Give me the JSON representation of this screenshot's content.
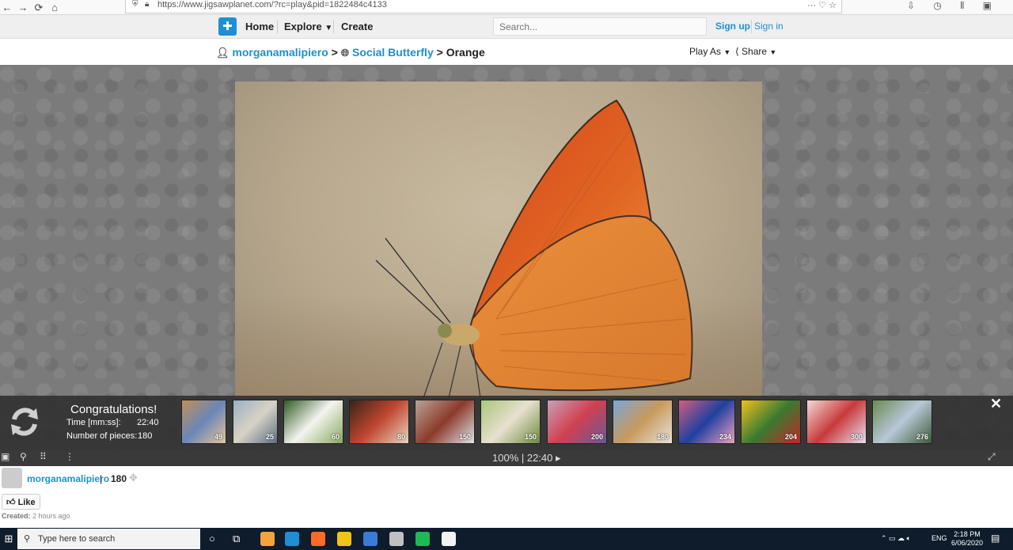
{
  "browser": {
    "url": "https://www.jigsawplanet.com/?rc=play&pid=1822484c4133",
    "url_icons": "··· ♡ ☆",
    "ext_icons": "⇩ ◷ ⫴ ▣ ☺"
  },
  "header": {
    "nav": [
      "Home",
      "Explore",
      "Create"
    ],
    "search_placeholder": "Search...",
    "signup": "Sign up",
    "signin": "Sign in"
  },
  "breadcrumb": {
    "user": "morganamalipiero",
    "sep1": ">",
    "collection": "Social Butterfly",
    "sep2": ">",
    "title": "Orange",
    "play_as": "Play As",
    "share": "Share"
  },
  "congrats": {
    "title": "Congratulations!",
    "time_label": "Time [mm:ss]:",
    "time_value": "22:40",
    "pieces_label": "Number of pieces:",
    "pieces_value": "180"
  },
  "thumbnails": [
    {
      "count": "49",
      "colors": [
        "#c28f5a",
        "#6a86b8",
        "#e6c69a"
      ]
    },
    {
      "count": "25",
      "colors": [
        "#9ab0c8",
        "#d8d2c4",
        "#5c6f86"
      ]
    },
    {
      "count": "60",
      "colors": [
        "#2f5b24",
        "#f4f4f0",
        "#88a860"
      ]
    },
    {
      "count": "80",
      "colors": [
        "#3a2418",
        "#c04630",
        "#e8d4c0"
      ]
    },
    {
      "count": "150",
      "colors": [
        "#b9a496",
        "#8c3a2a",
        "#e0e4ea"
      ]
    },
    {
      "count": "150",
      "colors": [
        "#a8c878",
        "#e8e0d0",
        "#6c8a3a"
      ]
    },
    {
      "count": "200",
      "colors": [
        "#c8a0b8",
        "#d04050",
        "#6a5898"
      ]
    },
    {
      "count": "180",
      "colors": [
        "#7aa6d8",
        "#c89a5c",
        "#e8e4dc"
      ]
    },
    {
      "count": "234",
      "colors": [
        "#d06080",
        "#2040a0",
        "#f0a0c0"
      ]
    },
    {
      "count": "204",
      "colors": [
        "#f0c020",
        "#3a7a30",
        "#c02828"
      ]
    },
    {
      "count": "300",
      "colors": [
        "#f4d8d8",
        "#c83a3a",
        "#e8e0f0"
      ]
    },
    {
      "count": "276",
      "colors": [
        "#6a8a50",
        "#b8c8d8",
        "#3e5a3a"
      ]
    }
  ],
  "toolbar": {
    "zoom_time": "100% | 22:40 ▸"
  },
  "below": {
    "author": "morganamalipiero",
    "divider": "|",
    "count": "180",
    "like": "Like",
    "created_label": "Created:",
    "created_value": "2 hours ago"
  },
  "taskbar": {
    "search_placeholder": "Type here to search",
    "lang": "ENG",
    "time": "2:18 PM",
    "date": "6/06/2020",
    "app_colors": [
      "#f3a43a",
      "#1e8fd4",
      "#ff6a2b",
      "#f0c419",
      "#3a7bd5",
      "#c0c0c0",
      "#1db954",
      "#f2f2f2",
      "#1e8fd4"
    ]
  }
}
